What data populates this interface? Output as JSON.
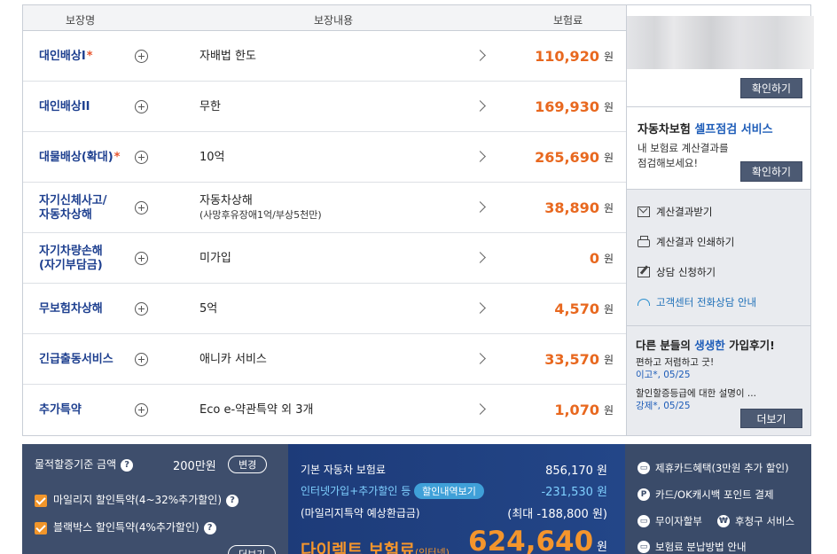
{
  "table": {
    "headers": {
      "name": "보장명",
      "content": "보장내용",
      "premium": "보험료"
    },
    "unit": "원",
    "rows": [
      {
        "name": "대인배상I",
        "star": "*",
        "content": "자배법 한도",
        "sub": "",
        "amount": "110,920"
      },
      {
        "name": "대인배상II",
        "star": "",
        "content": "무한",
        "sub": "",
        "amount": "169,930"
      },
      {
        "name": "대물배상(확대)",
        "star": "*",
        "content": "10억",
        "sub": "",
        "amount": "265,690"
      },
      {
        "name": "자기신체사고/\n자동차상해",
        "star": "",
        "content": "자동차상해",
        "sub": "(사망후유장애1억/부상5천만)",
        "amount": "38,890"
      },
      {
        "name": "자기차량손해\n(자기부담금)",
        "star": "",
        "content": "미가입",
        "sub": "",
        "amount": "0"
      },
      {
        "name": "무보험차상해",
        "star": "",
        "content": "5억",
        "sub": "",
        "amount": "4,570"
      },
      {
        "name": "긴급출동서비스",
        "star": "",
        "content": "애니카 서비스",
        "sub": "",
        "amount": "33,570"
      },
      {
        "name": "추가특약",
        "star": "",
        "content": "Eco e-약관특약 외 3개",
        "sub": "",
        "amount": "1,070"
      }
    ]
  },
  "side": {
    "confirm_label": "확인하기",
    "self_check": {
      "title_prefix": "자동차보험 ",
      "title_highlight": "셀프점검 서비스",
      "desc_line1": "내 보험료 계산결과를",
      "desc_line2": "점검해보세요!",
      "button": "확인하기"
    },
    "links": [
      {
        "icon": "mail-icon",
        "label": "계산결과받기"
      },
      {
        "icon": "print-icon",
        "label": "계산결과 인쇄하기"
      },
      {
        "icon": "edit-icon",
        "label": "상담 신청하기"
      },
      {
        "icon": "headset-icon",
        "label": "고객센터 전화상담 안내"
      }
    ],
    "reviews": {
      "title_prefix": "다른 분들의 ",
      "title_highlight": "생생한",
      "title_suffix": " 가입후기!",
      "items": [
        {
          "text": "편하고 저렴하고 굿!",
          "who": "이고*, 05/25"
        },
        {
          "text": "할인할증등급에 대한 설명이 ...",
          "who": "강제*, 05/25"
        }
      ],
      "more": "더보기"
    }
  },
  "bottom": {
    "left": {
      "threshold_label": "물적할증기준 금액",
      "threshold_value": "200만원",
      "change_button": "변경",
      "option1": "마일리지 할인특약(4~32%추가할인)",
      "option2": "블랙박스 할인특약(4%추가할인)",
      "more": "더보기"
    },
    "mid": {
      "base_label": "기본 자동차 보험료",
      "base_value": "856,170",
      "discount_label": "인터넷가입+추가할인 등",
      "discount_button": "할인내역보기",
      "discount_value": "-231,530",
      "mileage_label": "(마일리지특약 예상환급금)",
      "mileage_value": "(최대 -188,800 원)",
      "total_label": "다이렉트 보험료",
      "total_sub": "(인터넷)",
      "total_value": "624,640",
      "unit": "원"
    },
    "right": {
      "items": [
        {
          "icon": "card-icon",
          "label": "제휴카드혜택(3만원 추가 할인)"
        },
        {
          "icon": "point-icon",
          "label": "카드/OK캐시백 포인트 결제"
        },
        {
          "icon": "card-icon",
          "label": "무이자할부"
        },
        {
          "icon": "won-icon",
          "label": "후청구 서비스"
        },
        {
          "icon": "card-icon",
          "label": "보험료 분납방법 안내"
        }
      ]
    }
  }
}
